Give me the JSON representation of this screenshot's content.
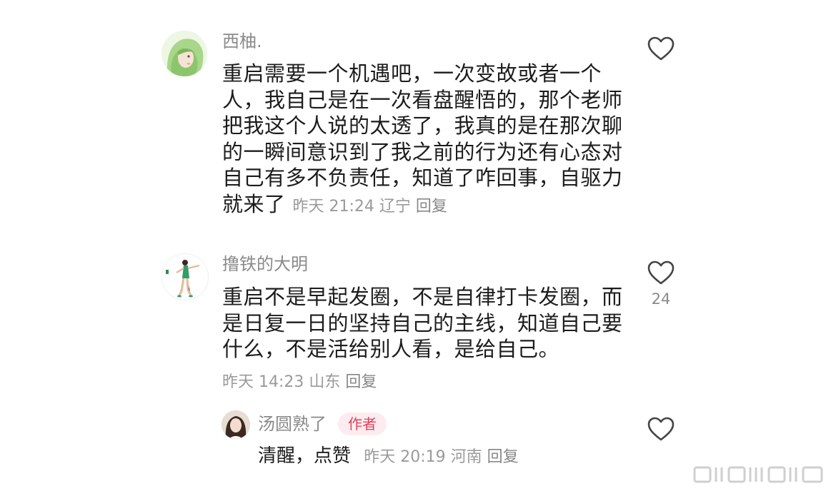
{
  "comments": [
    {
      "author": "西柚.",
      "lines": [
        "重启需要一个机遇吧，一次变故或者一个",
        "人，我自己是在一次看盘醒悟的，那个老师",
        "把我这个人说的太透了，我真的是在那次聊",
        "的一瞬间意识到了我之前的行为还有心态对",
        "自己有多不负责任，知道了咋回事，自驱力",
        "就来了"
      ],
      "meta": "昨天 21:24 辽宁",
      "reply_label": "回复",
      "likes": ""
    },
    {
      "author": "撸铁的大明",
      "lines": [
        "重启不是早起发圈，不是自律打卡发圈，而",
        "是日复一日的坚持自己的主线，知道自己要",
        "什么，不是活给别人看，是给自己。"
      ],
      "meta": "昨天 14:23 山东",
      "reply_label": "回复",
      "likes": "24"
    }
  ],
  "reply": {
    "author": "汤圆熟了",
    "badge": "作者",
    "text": "清醒，点赞",
    "meta": "昨天 20:19 河南",
    "reply_label": "回复"
  },
  "icons": {
    "like": "heart-outline-icon",
    "watermark": "weibo-watermark-icon"
  },
  "colors": {
    "badge_bg": "#fdecef",
    "badge_text": "#e0435b",
    "meta_text": "#9a9a9a"
  }
}
